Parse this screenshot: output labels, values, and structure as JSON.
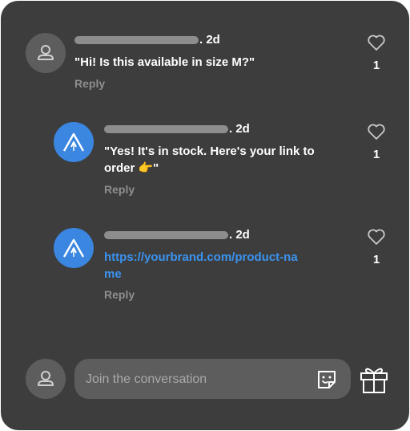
{
  "comments": [
    {
      "avatar": "person-icon",
      "age": ". 2d",
      "text": "\"Hi! Is this available in size M?\"",
      "reply_label": "Reply",
      "likes": "1"
    },
    {
      "avatar": "brand-logo-icon",
      "age": ". 2d",
      "text": "\"Yes! It's in stock. Here's your link to order 👉\"",
      "reply_label": "Reply",
      "likes": "1"
    },
    {
      "avatar": "brand-logo-icon",
      "age": ". 2d",
      "text": "https://yourbrand.com/product-name",
      "reply_label": "Reply",
      "likes": "1"
    }
  ],
  "composer": {
    "placeholder": "Join the conversation",
    "sticker_icon": "sticker-icon",
    "gift_icon": "gift-icon"
  },
  "colors": {
    "panel": "#3d3d3d",
    "link": "#3a93f0",
    "brand_avatar": "#3a86e0"
  }
}
